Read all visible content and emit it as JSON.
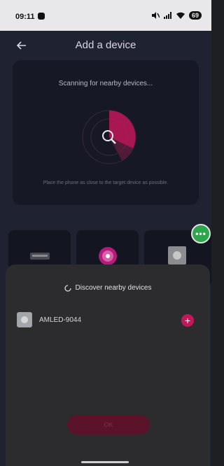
{
  "status_bar": {
    "time": "09:11",
    "battery": "69"
  },
  "app_bar": {
    "title": "Add a device",
    "back_icon": "arrow-left-icon"
  },
  "scan_card": {
    "scanning_text": "Scanning for nearby devices...",
    "hint_text": "Place the phone as close to the target device as possible.",
    "radar_icon": "search-icon"
  },
  "device_tiles": [
    {
      "icon": "hub-device-icon"
    },
    {
      "icon": "light-bulb-icon"
    },
    {
      "icon": "panel-device-icon"
    }
  ],
  "float_button": {
    "label": "•••",
    "color": "#2fa54d"
  },
  "sheet": {
    "discover_label": "Discover nearby devices",
    "devices": [
      {
        "name": "AMLED-9044",
        "action_icon": "plus-icon"
      }
    ],
    "ok_label": "OK"
  },
  "colors": {
    "accent": "#c2185b",
    "background": "#1f2231",
    "sheet": "#2c2c2e"
  }
}
